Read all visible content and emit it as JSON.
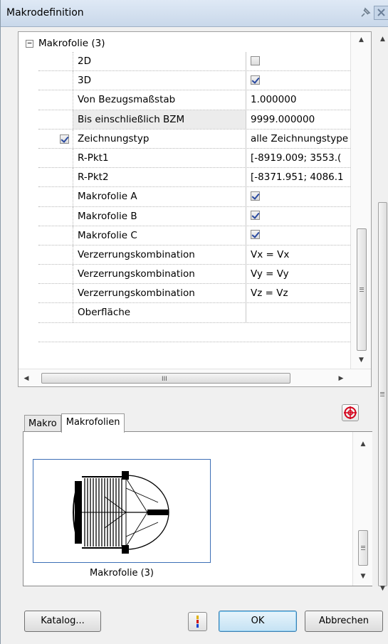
{
  "window": {
    "title": "Makrodefinition"
  },
  "grid": {
    "group_label": "Makrofolie (3)",
    "expander_glyph": "−",
    "rows": [
      {
        "label": "2D",
        "value": "",
        "value_check": "unchecked",
        "lead_check": "",
        "highlight": false
      },
      {
        "label": "3D",
        "value": "",
        "value_check": "checked",
        "lead_check": "",
        "highlight": false
      },
      {
        "label": "Von Bezugsmaßstab",
        "value": "1.000000",
        "value_check": "",
        "lead_check": "",
        "highlight": false
      },
      {
        "label": "Bis einschließlich BZM",
        "value": "9999.000000",
        "value_check": "",
        "lead_check": "",
        "highlight": true
      },
      {
        "label": "Zeichnungstyp",
        "value": "alle Zeichnungstype",
        "value_check": "",
        "lead_check": "checked",
        "highlight": false
      },
      {
        "label": "R-Pkt1",
        "value": "[-8919.009; 3553.(",
        "value_check": "",
        "lead_check": "",
        "highlight": false
      },
      {
        "label": "R-Pkt2",
        "value": "[-8371.951; 4086.1",
        "value_check": "",
        "lead_check": "",
        "highlight": false
      },
      {
        "label": "Makrofolie A",
        "value": "",
        "value_check": "checked",
        "lead_check": "",
        "highlight": false
      },
      {
        "label": "Makrofolie B",
        "value": "",
        "value_check": "checked",
        "lead_check": "",
        "highlight": false
      },
      {
        "label": "Makrofolie C",
        "value": "",
        "value_check": "checked",
        "lead_check": "",
        "highlight": false
      },
      {
        "label": "Verzerrungskombination",
        "value": "Vx = Vx",
        "value_check": "",
        "lead_check": "",
        "highlight": false
      },
      {
        "label": "Verzerrungskombination",
        "value": "Vy = Vy",
        "value_check": "",
        "lead_check": "",
        "highlight": false
      },
      {
        "label": "Verzerrungskombination",
        "value": "Vz = Vz",
        "value_check": "",
        "lead_check": "",
        "highlight": false
      },
      {
        "label": "Oberfläche",
        "value": "",
        "value_check": "",
        "lead_check": "",
        "highlight": false
      }
    ],
    "hscroll_grip": "III"
  },
  "tabs": [
    {
      "label": "Makro",
      "active": false
    },
    {
      "label": "Makrofolien",
      "active": true
    }
  ],
  "preview": {
    "caption": "Makrofolie (3)"
  },
  "buttons": {
    "katalog": "Katalog...",
    "ok": "OK",
    "abbrechen": "Abbrechen"
  },
  "icons": {
    "pin": "pin-icon",
    "close": "close-icon",
    "target": "target-icon",
    "color": "color-palette-icon"
  },
  "colors": {
    "selection_border": "#3d6fb6",
    "checkmark": "#2a4aa0",
    "target_red": "#d4001a"
  }
}
